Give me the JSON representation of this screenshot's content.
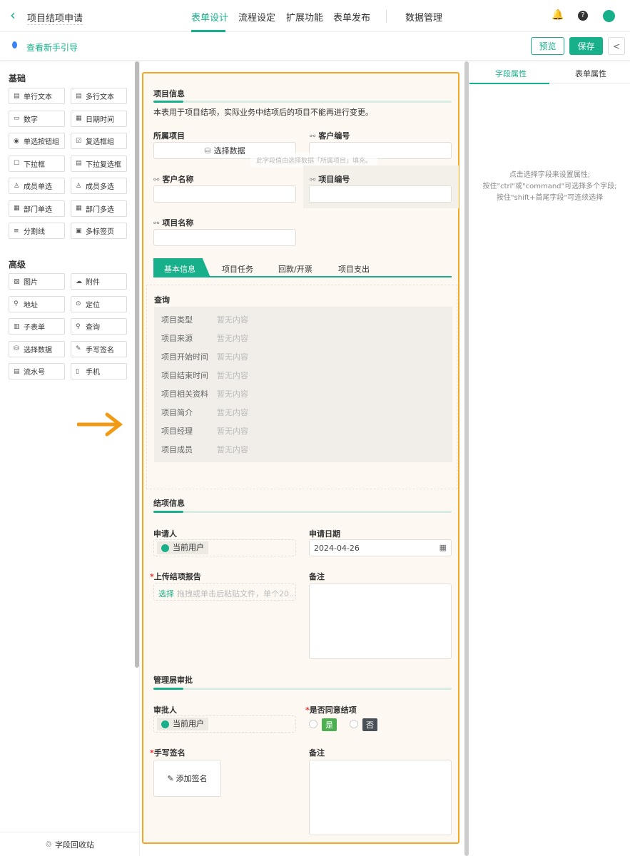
{
  "header": {
    "back_icon": "chevron-left-icon",
    "title": "项目结项申请",
    "tabs": [
      "表单设计",
      "流程设定",
      "扩展功能",
      "表单发布",
      "数据管理"
    ],
    "active_tab": 0
  },
  "subbar": {
    "guide": "查看新手引导",
    "preview": "预览",
    "save": "保存"
  },
  "sidebar": {
    "basic_title": "基础",
    "basic": [
      {
        "label": "单行文本",
        "icon": "text-icon"
      },
      {
        "label": "多行文本",
        "icon": "textarea-icon"
      },
      {
        "label": "数字",
        "icon": "number-icon"
      },
      {
        "label": "日期时间",
        "icon": "calendar-icon"
      },
      {
        "label": "单选按钮组",
        "icon": "radio-icon"
      },
      {
        "label": "复选框组",
        "icon": "checkbox-icon"
      },
      {
        "label": "下拉框",
        "icon": "dropdown-icon"
      },
      {
        "label": "下拉复选框",
        "icon": "multi-dropdown-icon"
      },
      {
        "label": "成员单选",
        "icon": "user-icon"
      },
      {
        "label": "成员多选",
        "icon": "users-icon"
      },
      {
        "label": "部门单选",
        "icon": "dept-icon"
      },
      {
        "label": "部门多选",
        "icon": "depts-icon"
      },
      {
        "label": "分割线",
        "icon": "divider-icon"
      },
      {
        "label": "多标签页",
        "icon": "tabs-icon"
      }
    ],
    "adv_title": "高级",
    "advanced": [
      {
        "label": "图片",
        "icon": "image-icon"
      },
      {
        "label": "附件",
        "icon": "upload-icon"
      },
      {
        "label": "地址",
        "icon": "pin-icon"
      },
      {
        "label": "定位",
        "icon": "locate-icon"
      },
      {
        "label": "子表单",
        "icon": "subform-icon"
      },
      {
        "label": "查询",
        "icon": "query-icon"
      },
      {
        "label": "选择数据",
        "icon": "database-icon"
      },
      {
        "label": "手写签名",
        "icon": "pen-icon"
      },
      {
        "label": "流水号",
        "icon": "serial-icon"
      },
      {
        "label": "手机",
        "icon": "phone-icon"
      }
    ],
    "recycle": "字段回收站"
  },
  "form": {
    "s1_title": "项目信息",
    "s1_desc": "本表用于项目结项，实际业务中结项后的项目不能再进行变更。",
    "f_project": "所属项目",
    "select_data": "选择数据",
    "f_cust_no": "客户编号",
    "tooltip": "此字段值由选择数据「所属项目」填充。",
    "f_cust_name": "客户名称",
    "f_proj_no": "项目编号",
    "f_proj_name": "项目名称",
    "tabs": [
      "基本信息",
      "项目任务",
      "回款/开票",
      "项目支出"
    ],
    "query_title": "查询",
    "query_rows": [
      "项目类型",
      "项目来源",
      "项目开始时间",
      "项目结束时间",
      "项目相关资料",
      "项目简介",
      "项目经理",
      "项目成员"
    ],
    "empty": "暂无内容",
    "s2_title": "结项信息",
    "applicant": "申请人",
    "current_user": "当前用户",
    "apply_date": "申请日期",
    "date_value": "2024-04-26",
    "upload": "上传结项报告",
    "upload_select": "选择",
    "upload_hint": "拖拽或单击后粘贴文件，单个20...",
    "remark": "备注",
    "s3_title": "管理层审批",
    "approver": "审批人",
    "agree": "是否同意结项",
    "yes": "是",
    "no": "否",
    "signature": "手写签名",
    "add_sign": "添加签名",
    "remark2": "备注"
  },
  "right": {
    "tabs": [
      "字段属性",
      "表单属性"
    ],
    "hint1": "点击选择字段来设置属性;",
    "hint2": "按住\"ctrl\"或\"command\"可选择多个字段;",
    "hint3": "按住\"shift+首尾字段\"可连续选择"
  }
}
